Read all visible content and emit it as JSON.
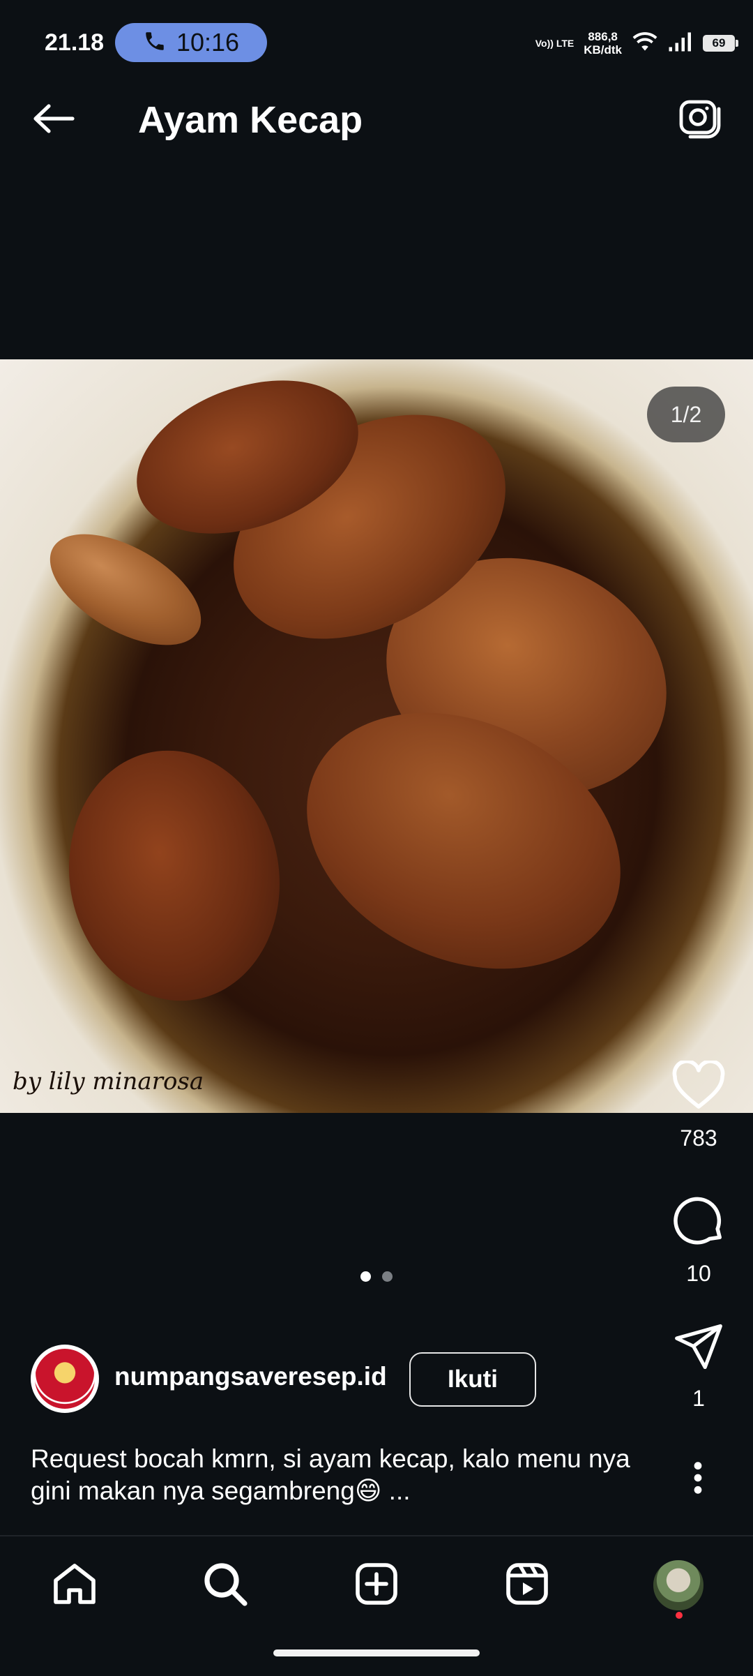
{
  "status_bar": {
    "time": "21.18",
    "call_time": "10:16",
    "volte": "Vo)) LTE",
    "speed_value": "886,8",
    "speed_unit": "KB/dtk",
    "battery": "69"
  },
  "header": {
    "title": "Ayam Kecap",
    "back_icon": "arrow-left-icon",
    "camera_icon": "camera-icon"
  },
  "media": {
    "counter": "1/2",
    "watermark": "by lily minarosa",
    "current_page": 1,
    "total_pages": 2
  },
  "actions": {
    "likes": "783",
    "comments": "10",
    "shares": "1"
  },
  "post": {
    "username": "numpangsaveresep.id",
    "follow_label": "Ikuti",
    "caption": "Request bocah kmrn, si ayam kecap, kalo menu nya gini makan nya segambreng😄 ..."
  },
  "nav": {
    "items": [
      "home-icon",
      "search-icon",
      "create-icon",
      "reels-icon",
      "profile-avatar"
    ]
  },
  "colors": {
    "background": "#0c1014",
    "call_pill": "#6d8fe4",
    "notification": "#ff3040"
  }
}
